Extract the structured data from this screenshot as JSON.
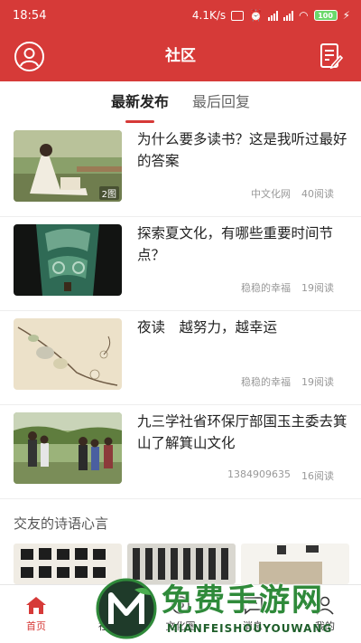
{
  "status_bar": {
    "time": "18:54",
    "network_speed": "4.1K/s",
    "battery": "100"
  },
  "header": {
    "title": "社区",
    "left_icon": "user-avatar-icon",
    "right_icon": "compose-icon"
  },
  "tabs": [
    {
      "label": "最新发布",
      "active": true
    },
    {
      "label": "最后回复",
      "active": false
    }
  ],
  "articles": [
    {
      "title": "为什么要多读书？这是我听过最好的答案",
      "author": "中文化网",
      "reads": "40阅读",
      "image_count": "2图"
    },
    {
      "title": "探索夏文化，有哪些重要时间节点？",
      "author": "稳稳的幸福",
      "reads": "19阅读",
      "image_count": ""
    },
    {
      "title": "夜读　越努力，越幸运",
      "author": "稳稳的幸福",
      "reads": "19阅读",
      "image_count": ""
    },
    {
      "title": "九三学社省环保厅部国玉主委去箕山了解箕山文化",
      "author": "1384909635",
      "reads": "16阅读",
      "image_count": ""
    }
  ],
  "section": {
    "title": "交友的诗语心言"
  },
  "bottom_nav": [
    {
      "label": "首页",
      "icon": "home-icon",
      "active": true
    },
    {
      "label": "社区",
      "icon": "community-icon",
      "active": false
    },
    {
      "label": "文化圈",
      "icon": "culture-icon",
      "active": false
    },
    {
      "label": "消息",
      "icon": "message-icon",
      "active": false
    },
    {
      "label": "我的",
      "icon": "profile-icon",
      "active": false
    }
  ],
  "watermark": {
    "text": "免费手游网",
    "subtext": "MIANFEISHOUYOUWANG"
  },
  "colors": {
    "brand_red": "#d63a38",
    "watermark_green": "#2f8a3a"
  }
}
